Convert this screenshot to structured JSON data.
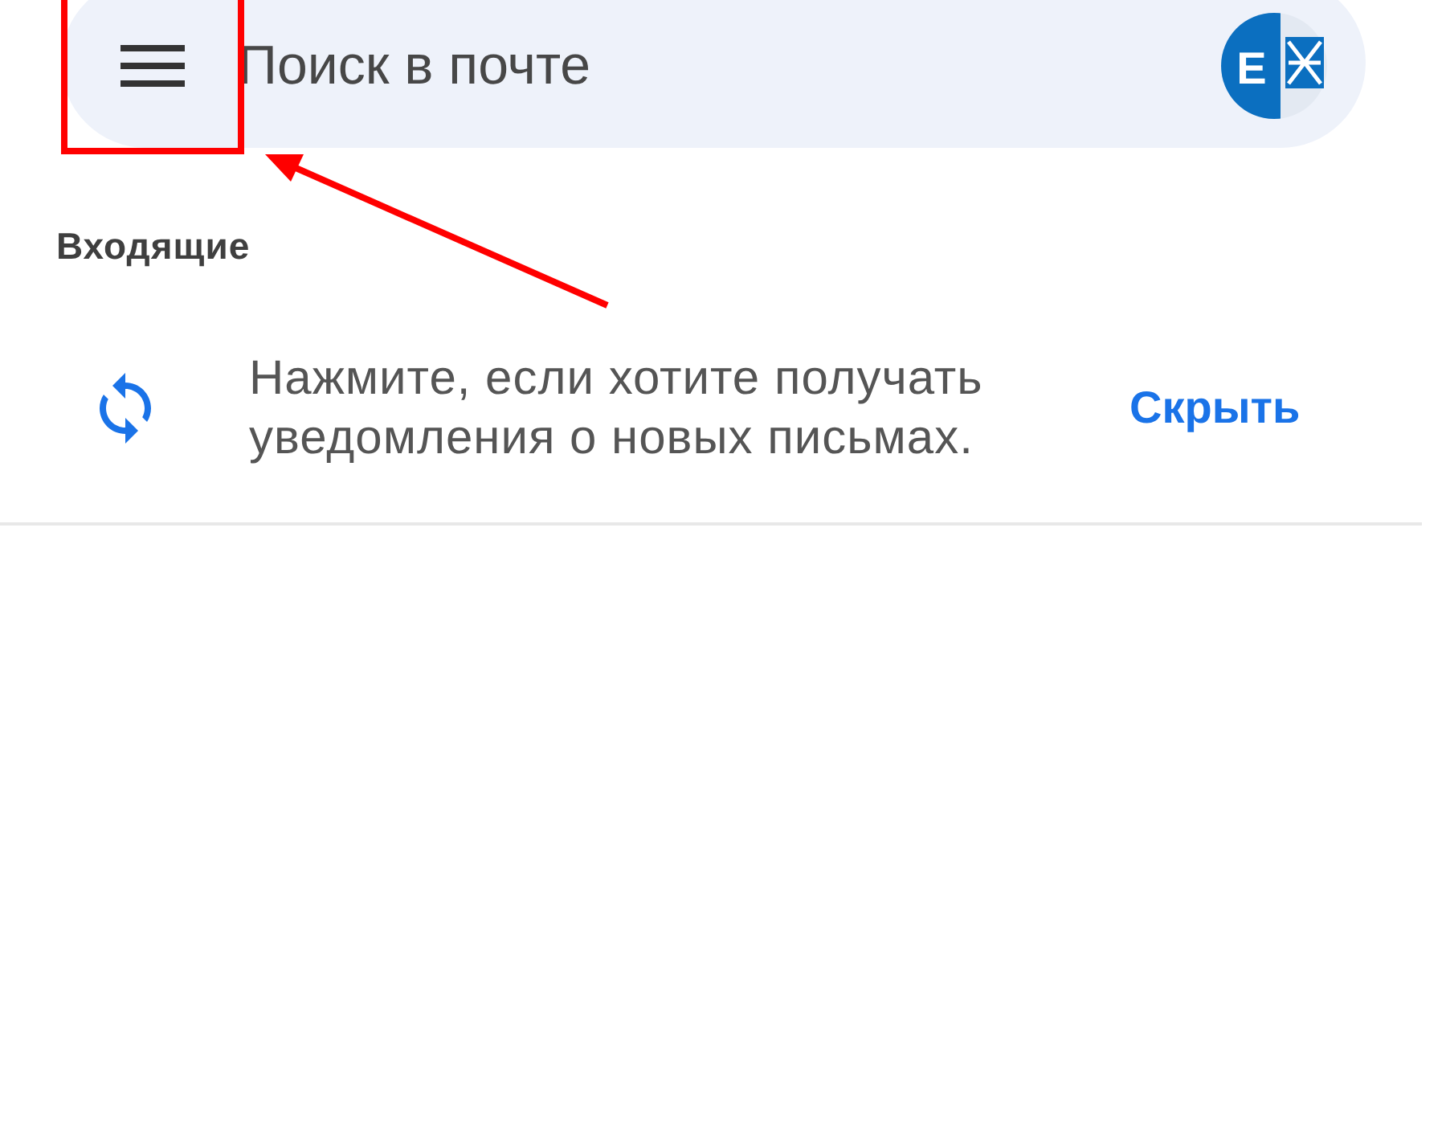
{
  "search": {
    "placeholder": "Поиск в почте"
  },
  "account": {
    "logo_letter": "E"
  },
  "folder": {
    "title": "Входящие"
  },
  "banner": {
    "message": "Нажмите, если хотите получать уведомления о новых письмах.",
    "action": "Скрыть"
  }
}
